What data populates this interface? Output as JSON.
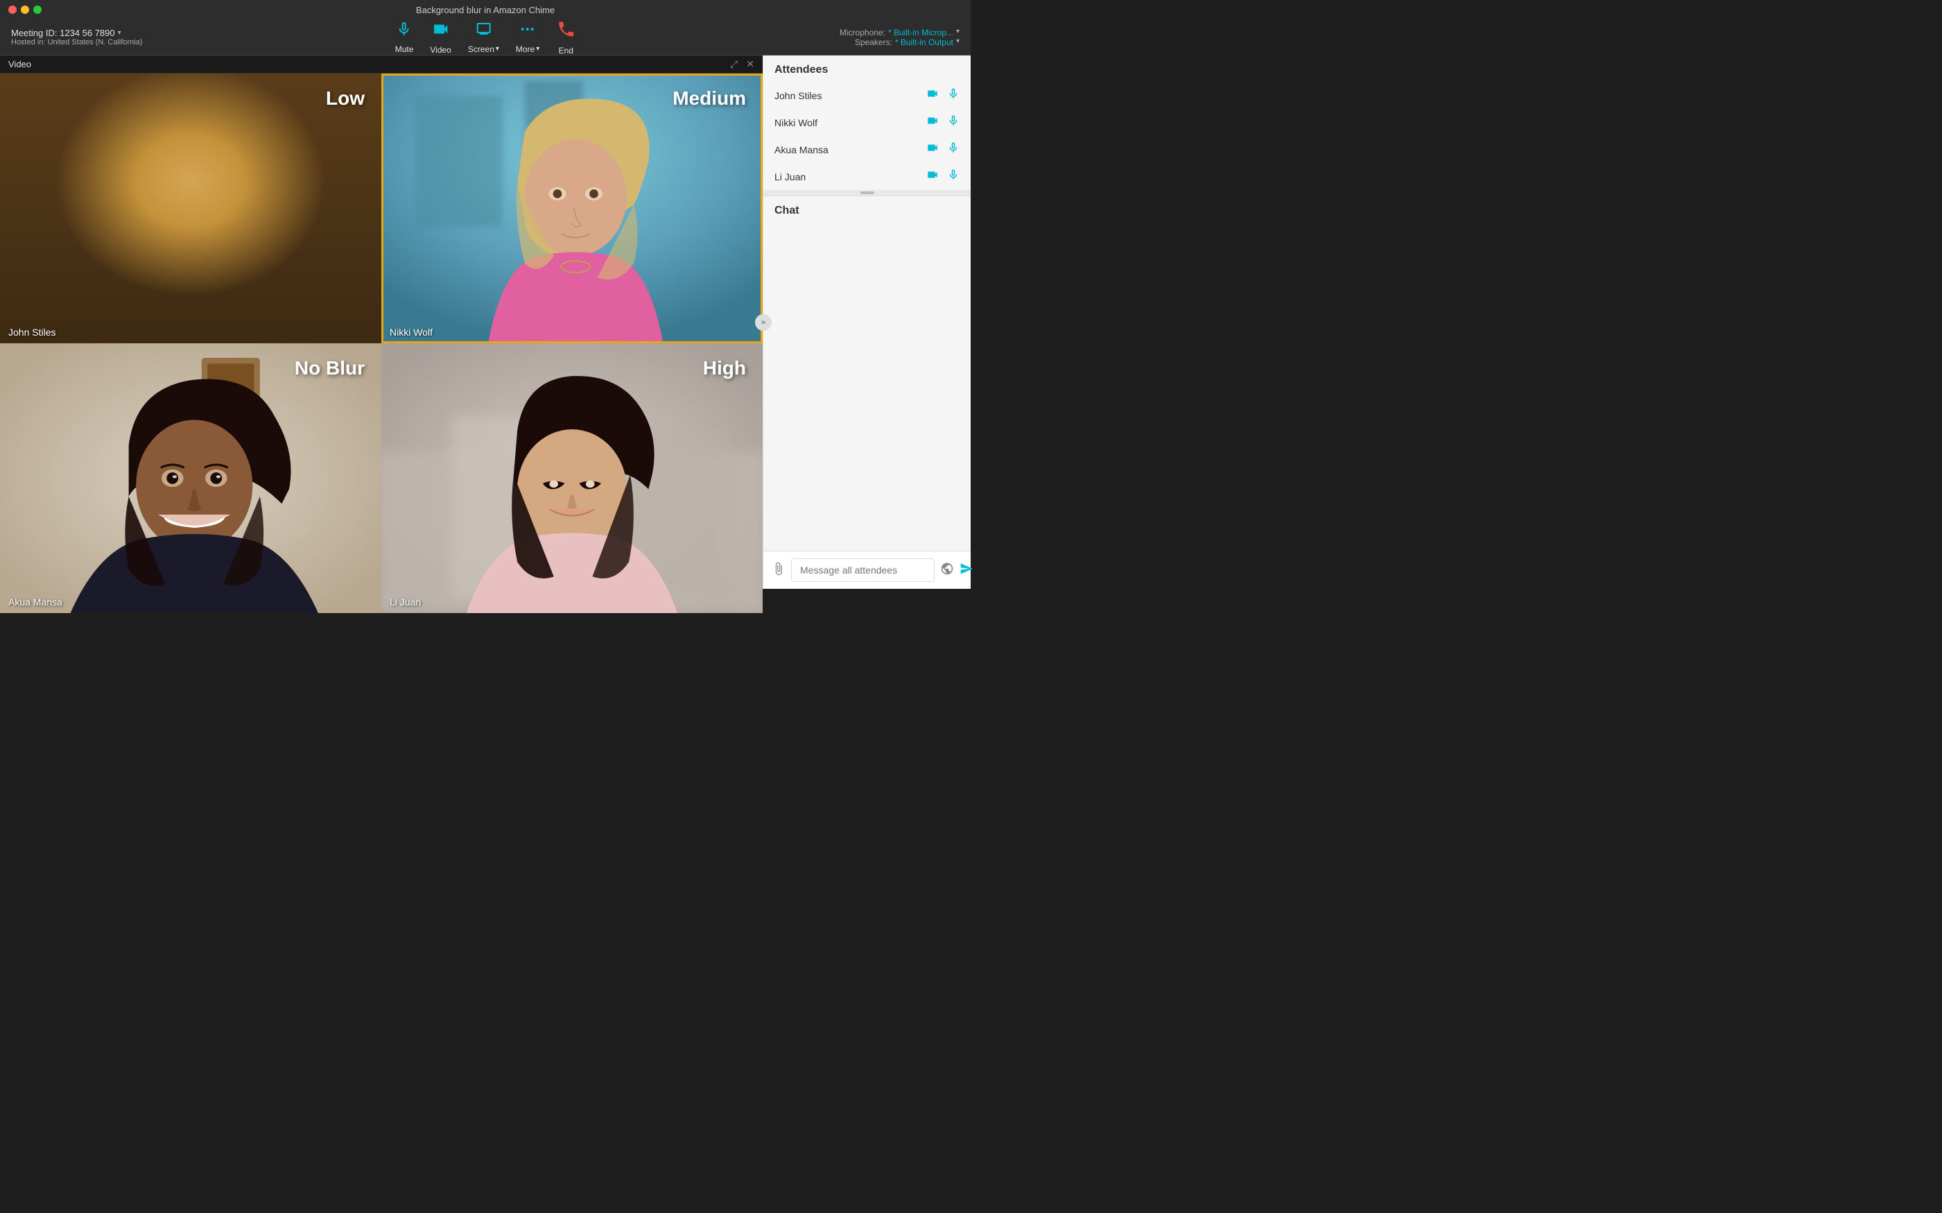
{
  "titleBar": {
    "title": "Background blur in Amazon Chime"
  },
  "menuBar": {
    "meetingId": "Meeting ID: 1234 56 7890",
    "hostedIn": "Hosted in: United States (N. California)",
    "controls": {
      "mute": {
        "label": "Mute",
        "icon": "🎤"
      },
      "video": {
        "label": "Video",
        "icon": "📹"
      },
      "screen": {
        "label": "Screen",
        "icon": "🖥"
      },
      "more": {
        "label": "More",
        "icon": "•••"
      },
      "end": {
        "label": "End",
        "icon": "📞"
      }
    },
    "microphone": {
      "label": "Microphone:",
      "value": "* Built-in Microp..."
    },
    "speakers": {
      "label": "Speakers:",
      "value": "* Built-in Output"
    }
  },
  "videoPanel": {
    "title": "Video",
    "participants": [
      {
        "id": "john-stiles",
        "name": "John Stiles",
        "blurLabel": "Low",
        "active": false,
        "bgClass": "bg-john"
      },
      {
        "id": "nikki-wolf",
        "name": "Nikki Wolf",
        "blurLabel": "Medium",
        "active": true,
        "bgClass": "bg-nikki"
      },
      {
        "id": "akua-mansa",
        "name": "Akua Mansa",
        "blurLabel": "No Blur",
        "active": false,
        "bgClass": "bg-akua"
      },
      {
        "id": "li-juan",
        "name": "Li Juan",
        "blurLabel": "High",
        "active": false,
        "bgClass": "bg-lijuan"
      }
    ]
  },
  "attendees": {
    "header": "Attendees",
    "list": [
      {
        "name": "John Stiles"
      },
      {
        "name": "Nikki Wolf"
      },
      {
        "name": "Akua Mansa"
      },
      {
        "name": "Li Juan"
      }
    ]
  },
  "chat": {
    "header": "Chat",
    "inputPlaceholder": "Message all attendees"
  }
}
